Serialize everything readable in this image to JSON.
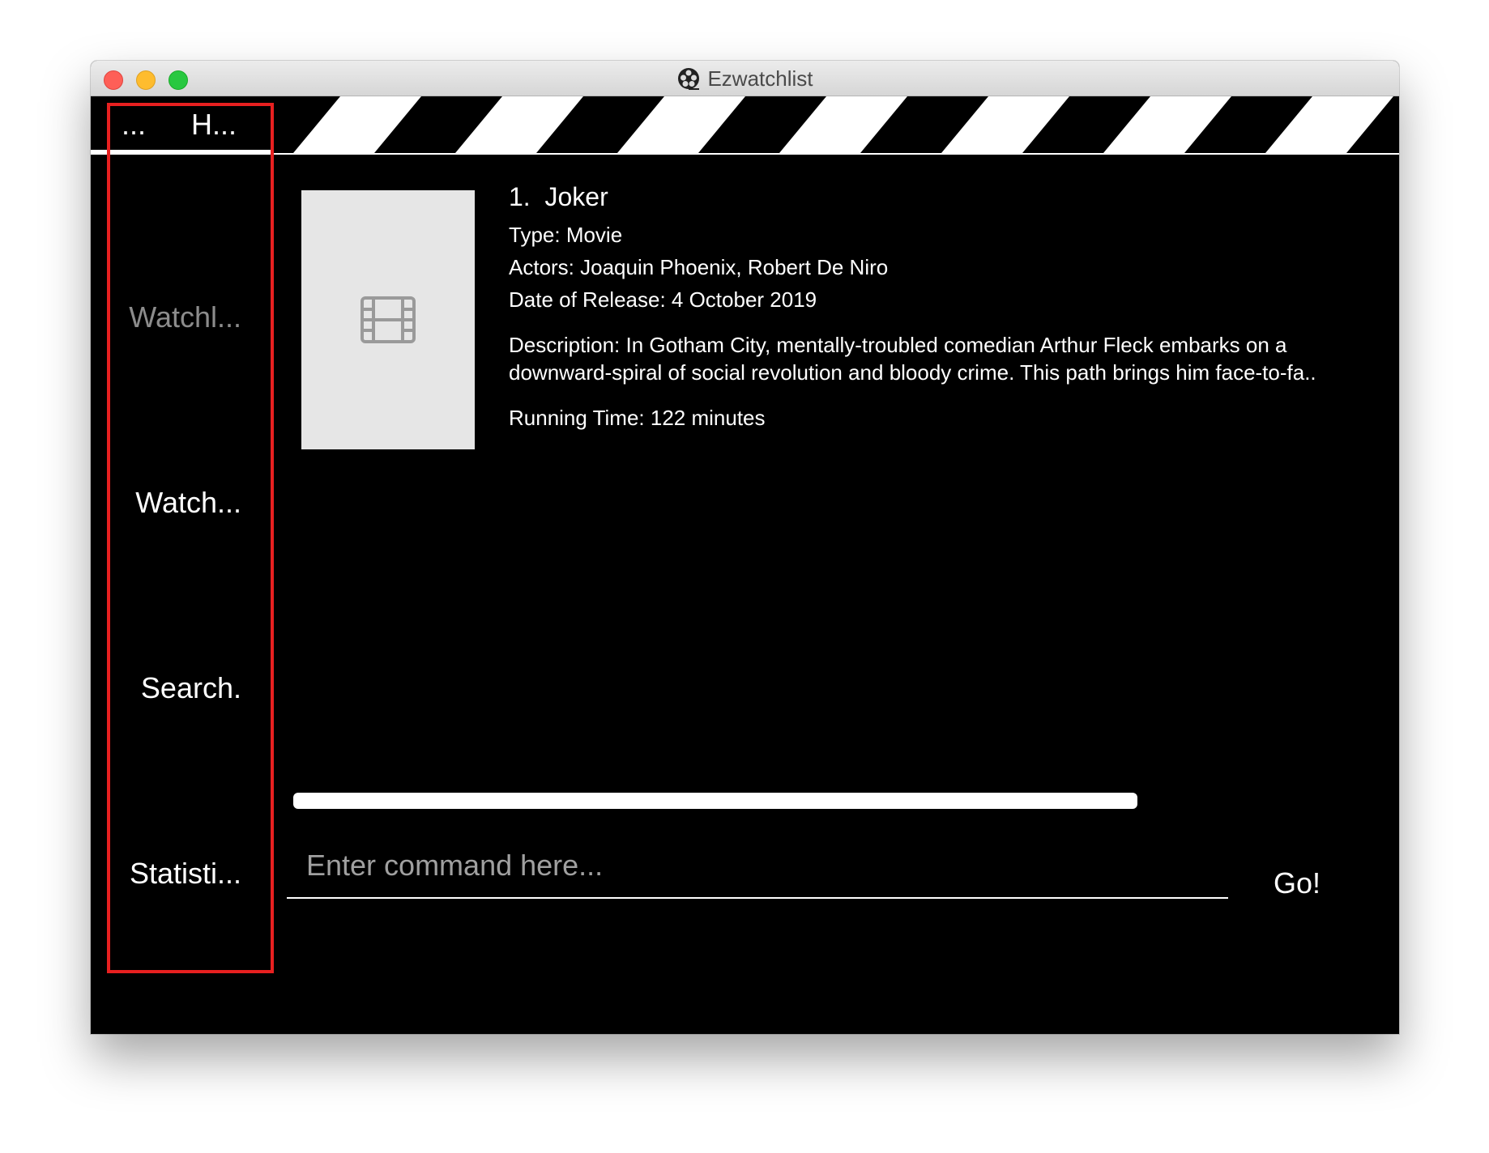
{
  "window": {
    "title": "Ezwatchlist"
  },
  "menu": {
    "file_label": "...",
    "help_label": "H..."
  },
  "sidebar": {
    "items": [
      {
        "label": "Watchl...",
        "active": false
      },
      {
        "label": "Watch...",
        "active": true
      },
      {
        "label": "Search.",
        "active": true
      },
      {
        "label": "Statisti...",
        "active": true
      }
    ]
  },
  "movie": {
    "index": "1.",
    "title": "Joker",
    "type": "Type: Movie",
    "actors": "Actors:   Joaquin Phoenix, Robert De Niro",
    "release": "Date of Release: 4 October 2019",
    "description_line1": "Description: In Gotham City, mentally-troubled comedian Arthur Fleck embarks on a",
    "description_line2": "downward-spiral of social revolution and bloody crime. This path brings him face-to-fa..",
    "running_time": "Running Time: 122 minutes"
  },
  "command": {
    "placeholder": "Enter command here...",
    "go_label": "Go!"
  },
  "progress": {
    "value": 1.0
  },
  "icons": {
    "app": "film-reel-icon",
    "poster": "film-icon"
  },
  "colors": {
    "background": "#000000",
    "highlight_border": "#e82020",
    "poster_bg": "#e6e6e6"
  }
}
